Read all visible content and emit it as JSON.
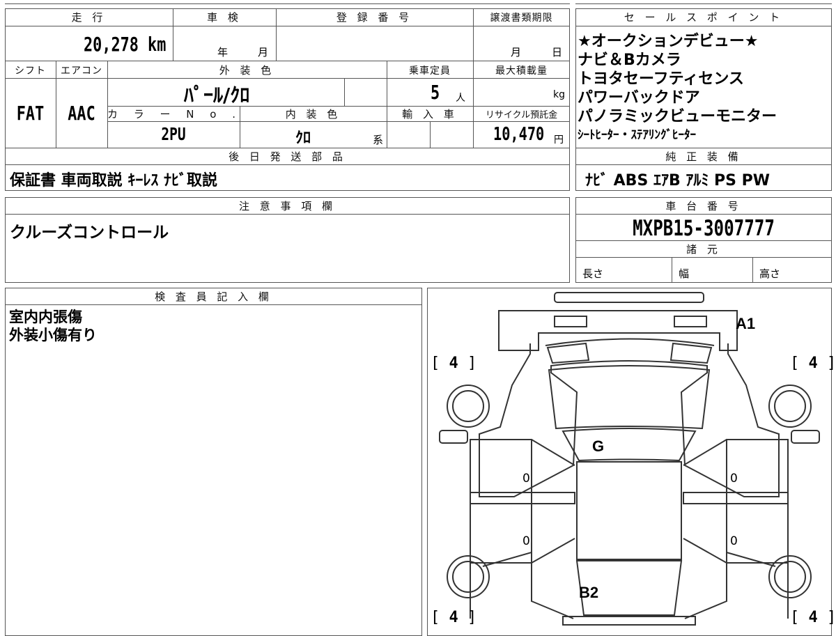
{
  "labels": {
    "mileage": "走 行",
    "inspection": "車 検",
    "registration_no": "登 録 番 号",
    "transfer_deadline": "譲渡書類期限",
    "sales_points": "セ ー ル ス ポ イ ン ト",
    "shift": "シフト",
    "aircon": "エアコン",
    "exterior_color": "外 装 色",
    "capacity": "乗車定員",
    "max_load": "最大積載量",
    "color_no": "カ ラ ー N o .",
    "interior_color": "内 装 色",
    "imported": "輸 入 車",
    "recycle_fee": "リサイクル預託金",
    "later_parts": "後 日 発 送 部 品",
    "genuine_equipment": "純 正 装 備",
    "notes": "注 意 事 項 欄",
    "chassis_no": "車 台 番 号",
    "specs": "諸 元",
    "length": "長さ",
    "width": "幅",
    "height": "高さ",
    "inspector": "検 査 員 記 入 欄",
    "year_unit": "年",
    "month_unit": "月",
    "day_unit": "日",
    "month_unit2": "月",
    "person_unit": "人",
    "kg_unit": "kg",
    "yen_unit": "円",
    "kei_suffix": "系"
  },
  "vehicle": {
    "mileage": "20,278 km",
    "shift": "FAT",
    "aircon": "AAC",
    "exterior_color": "ﾊﾟｰﾙ/ｸﾛ",
    "capacity": "5",
    "color_no": "2PU",
    "interior_color": "ｸﾛ",
    "recycle_fee": "10,470",
    "chassis_no": "MXPB15-3007777"
  },
  "sales_points": [
    "★オークションデビュー★",
    "ナビ＆Bカメラ",
    "トヨタセーフティセンス",
    "パワーバックドア",
    "パノラミックビューモニター",
    "ｼｰﾄﾋｰﾀｰ・ｽﾃｱﾘﾝｸﾞﾋｰﾀｰ"
  ],
  "later_parts_text": "保証書 車両取説 ｷｰﾚｽ ﾅﾋﾞ取説",
  "genuine_equipment_text": "ﾅﾋﾞ ABS ｴｱB ｱﾙﾐ PS PW",
  "notes_text": "クルーズコントロール",
  "inspector_lines": [
    "室内内張傷",
    "外装小傷有り"
  ],
  "damage_marks": {
    "rear_roof": "A1",
    "windshield": "G",
    "hood": "B2",
    "tire_tl": "4",
    "tire_tr": "4",
    "tire_bl": "4",
    "tire_br": "4",
    "left_front_door": "0",
    "left_rear_door": "0",
    "right_front_door": "0",
    "right_rear_door": "0"
  },
  "bracket_open": "[",
  "bracket_close": "]"
}
